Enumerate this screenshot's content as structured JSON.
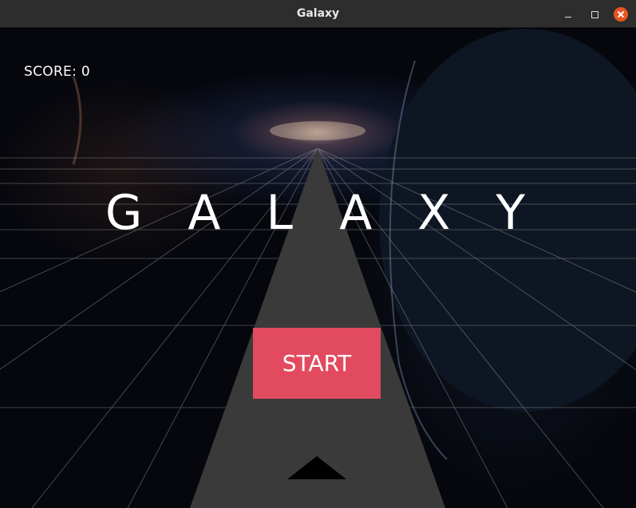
{
  "window": {
    "title": "Galaxy",
    "controls": [
      "minimize-icon",
      "maximize-icon",
      "close-icon"
    ],
    "close_color": "#e95420"
  },
  "game": {
    "score_text": "SCORE: 0",
    "title": "G A L A X Y",
    "start_label": "START",
    "start_color": "#e24b5f",
    "track_color": "#3a3a3a",
    "grid_color": "#9a9a9a"
  }
}
